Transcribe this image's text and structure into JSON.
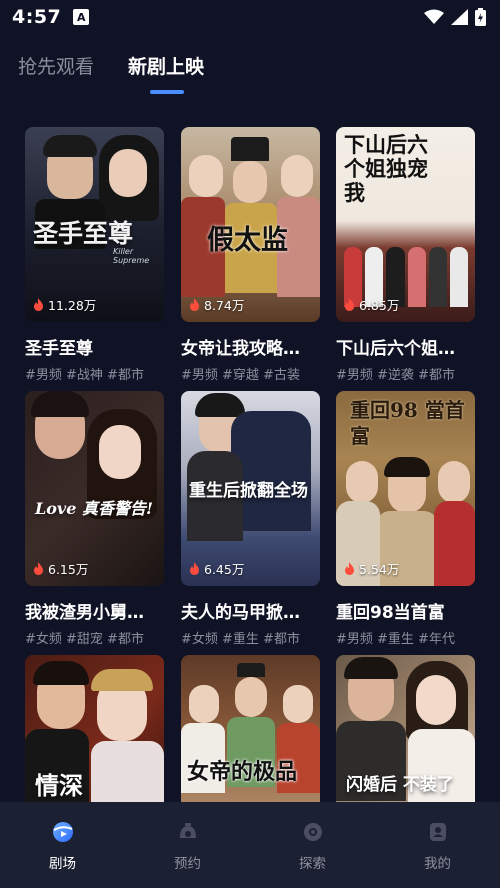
{
  "status": {
    "time": "4:57",
    "app_icon_letter": "A"
  },
  "tabs": [
    {
      "label": "抢先观看"
    },
    {
      "label": "新剧上映"
    }
  ],
  "dramas": [
    {
      "title": "圣手至尊",
      "views": "11.28万",
      "tags": "#男频 #战神 #都市",
      "poster_text": "圣手至尊",
      "poster_sub": "Killer Supreme"
    },
    {
      "title": "女帝让我攻略…",
      "views": "8.74万",
      "tags": "#男频 #穿越 #古装",
      "poster_text": "假太监"
    },
    {
      "title": "下山后六个姐…",
      "views": "6.85万",
      "tags": "#男频 #逆袭 #都市",
      "poster_text": "下山后六个姐独宠我"
    },
    {
      "title": "我被渣男小舅…",
      "views": "6.15万",
      "tags": "#女频 #甜宠 #都市",
      "poster_text": "Love 真香警告!"
    },
    {
      "title": "夫人的马甲掀…",
      "views": "6.45万",
      "tags": "#女频 #重生 #都市",
      "poster_text": "重生后掀翻全场"
    },
    {
      "title": "重回98当首富",
      "views": "5.54万",
      "tags": "#男频 #重生 #年代",
      "poster_text": "重回98 當首富"
    },
    {
      "title": "",
      "views": "",
      "tags": "",
      "poster_text": "情深"
    },
    {
      "title": "",
      "views": "",
      "tags": "",
      "poster_text": "女帝的极品"
    },
    {
      "title": "",
      "views": "",
      "tags": "",
      "poster_text": "闪婚后 不装了"
    }
  ],
  "nav": [
    {
      "label": "剧场",
      "icon": "theater-icon"
    },
    {
      "label": "预约",
      "icon": "reserve-icon"
    },
    {
      "label": "探索",
      "icon": "explore-icon"
    },
    {
      "label": "我的",
      "icon": "profile-icon"
    }
  ],
  "colors": {
    "background": "#0f1325",
    "accent": "#4a8dff",
    "nav_bg": "#1c2033",
    "fire": "#ff4d3d"
  }
}
